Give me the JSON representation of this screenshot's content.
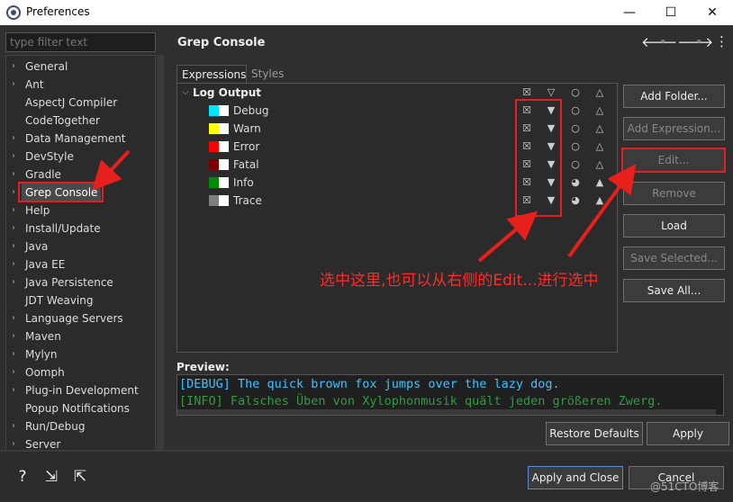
{
  "window": {
    "title": "Preferences",
    "minimize": "—",
    "maximize": "☐",
    "close": "✕"
  },
  "filter": {
    "placeholder": "type filter text"
  },
  "tree": [
    {
      "label": "General",
      "arrow": true
    },
    {
      "label": "Ant",
      "arrow": true
    },
    {
      "label": "AspectJ Compiler",
      "arrow": false
    },
    {
      "label": "CodeTogether",
      "arrow": false
    },
    {
      "label": "Data Management",
      "arrow": true
    },
    {
      "label": "DevStyle",
      "arrow": true
    },
    {
      "label": "Gradle",
      "arrow": true
    },
    {
      "label": "Grep Console",
      "arrow": true,
      "selected": true
    },
    {
      "label": "Help",
      "arrow": true
    },
    {
      "label": "Install/Update",
      "arrow": true
    },
    {
      "label": "Java",
      "arrow": true
    },
    {
      "label": "Java EE",
      "arrow": true
    },
    {
      "label": "Java Persistence",
      "arrow": true
    },
    {
      "label": "JDT Weaving",
      "arrow": false
    },
    {
      "label": "Language Servers",
      "arrow": true
    },
    {
      "label": "Maven",
      "arrow": true
    },
    {
      "label": "Mylyn",
      "arrow": true
    },
    {
      "label": "Oomph",
      "arrow": true
    },
    {
      "label": "Plug-in Development",
      "arrow": true
    },
    {
      "label": "Popup Notifications",
      "arrow": false
    },
    {
      "label": "Run/Debug",
      "arrow": true
    },
    {
      "label": "Server",
      "arrow": true
    }
  ],
  "page": {
    "title": "Grep Console"
  },
  "tabs": {
    "expressions": "Expressions",
    "styles": "Styles"
  },
  "group": {
    "label": "Log Output"
  },
  "expressions": [
    {
      "label": "Debug",
      "c1": "#00e5ff",
      "c2": "#ffffff"
    },
    {
      "label": "Warn",
      "c1": "#ffff00",
      "c2": "#ffffff"
    },
    {
      "label": "Error",
      "c1": "#ff0000",
      "c2": "#ffffff"
    },
    {
      "label": "Fatal",
      "c1": "#7a0000",
      "c2": "#ffffff"
    },
    {
      "label": "Info",
      "c1": "#008a00",
      "c2": "#ffffff"
    },
    {
      "label": "Trace",
      "c1": "#808080",
      "c2": "#ffffff"
    }
  ],
  "buttons": {
    "add_folder": "Add Folder...",
    "add_expression": "Add Expression...",
    "edit": "Edit...",
    "remove": "Remove",
    "load": "Load",
    "save_selected": "Save Selected...",
    "save_all": "Save All..."
  },
  "preview": {
    "label": "Preview:",
    "line1": "[DEBUG] The quick brown fox jumps over the lazy dog.",
    "line2": "[INFO] Falsches Üben von Xylophonmusik quält jeden größeren Zwerg."
  },
  "footer": {
    "restore": "Restore Defaults",
    "apply": "Apply",
    "apply_close": "Apply and Close",
    "cancel": "Cancel"
  },
  "annotation": {
    "text": "选中这里,也可以从右侧的Edit...进行选中",
    "color": "#ff2a2a"
  },
  "watermark": "@51CTO博客"
}
